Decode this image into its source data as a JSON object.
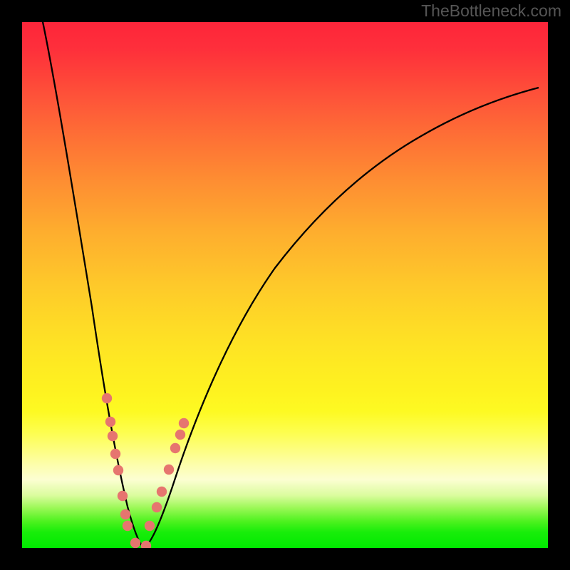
{
  "watermark": "TheBottleneck.com",
  "colors": {
    "frame": "#000000",
    "curve_stroke": "#000000",
    "dots_fill": "#e6756f",
    "gradient_top": "#fe253a",
    "gradient_bottom": "#00eb00"
  },
  "chart_data": {
    "type": "line",
    "title": "",
    "xlabel": "",
    "ylabel": "",
    "xlim": [
      0,
      1
    ],
    "ylim": [
      0,
      1
    ],
    "notes": "V-shaped bottleneck curve. Left branch descends steeply from top-left to minimum near x≈0.22, right branch ascends with diminishing slope toward upper right. Background is a vertical heat gradient (red→orange→yellow→green). Axes have no visible tick labels. Salmon-colored dots cluster on both branches in the lower (green/yellow) region near the valley.",
    "series": [
      {
        "name": "bottleneck-curve-left",
        "x": [
          0.038,
          0.06,
          0.08,
          0.1,
          0.12,
          0.14,
          0.16,
          0.175,
          0.19,
          0.205,
          0.215,
          0.225
        ],
        "y": [
          1.0,
          0.9,
          0.79,
          0.675,
          0.56,
          0.43,
          0.3,
          0.2,
          0.11,
          0.04,
          0.01,
          0.0
        ]
      },
      {
        "name": "bottleneck-curve-right",
        "x": [
          0.225,
          0.25,
          0.28,
          0.32,
          0.37,
          0.43,
          0.5,
          0.58,
          0.66,
          0.74,
          0.82,
          0.9,
          0.975
        ],
        "y": [
          0.0,
          0.06,
          0.15,
          0.27,
          0.39,
          0.49,
          0.575,
          0.65,
          0.71,
          0.76,
          0.805,
          0.845,
          0.87
        ]
      },
      {
        "name": "left-dots",
        "x": [
          0.161,
          0.168,
          0.172,
          0.178,
          0.183,
          0.191,
          0.196,
          0.201
        ],
        "y": [
          0.284,
          0.24,
          0.212,
          0.179,
          0.148,
          0.099,
          0.064,
          0.042
        ]
      },
      {
        "name": "right-dots",
        "x": [
          0.243,
          0.256,
          0.265,
          0.279,
          0.291,
          0.301,
          0.307
        ],
        "y": [
          0.042,
          0.077,
          0.107,
          0.149,
          0.189,
          0.216,
          0.237
        ]
      }
    ]
  }
}
